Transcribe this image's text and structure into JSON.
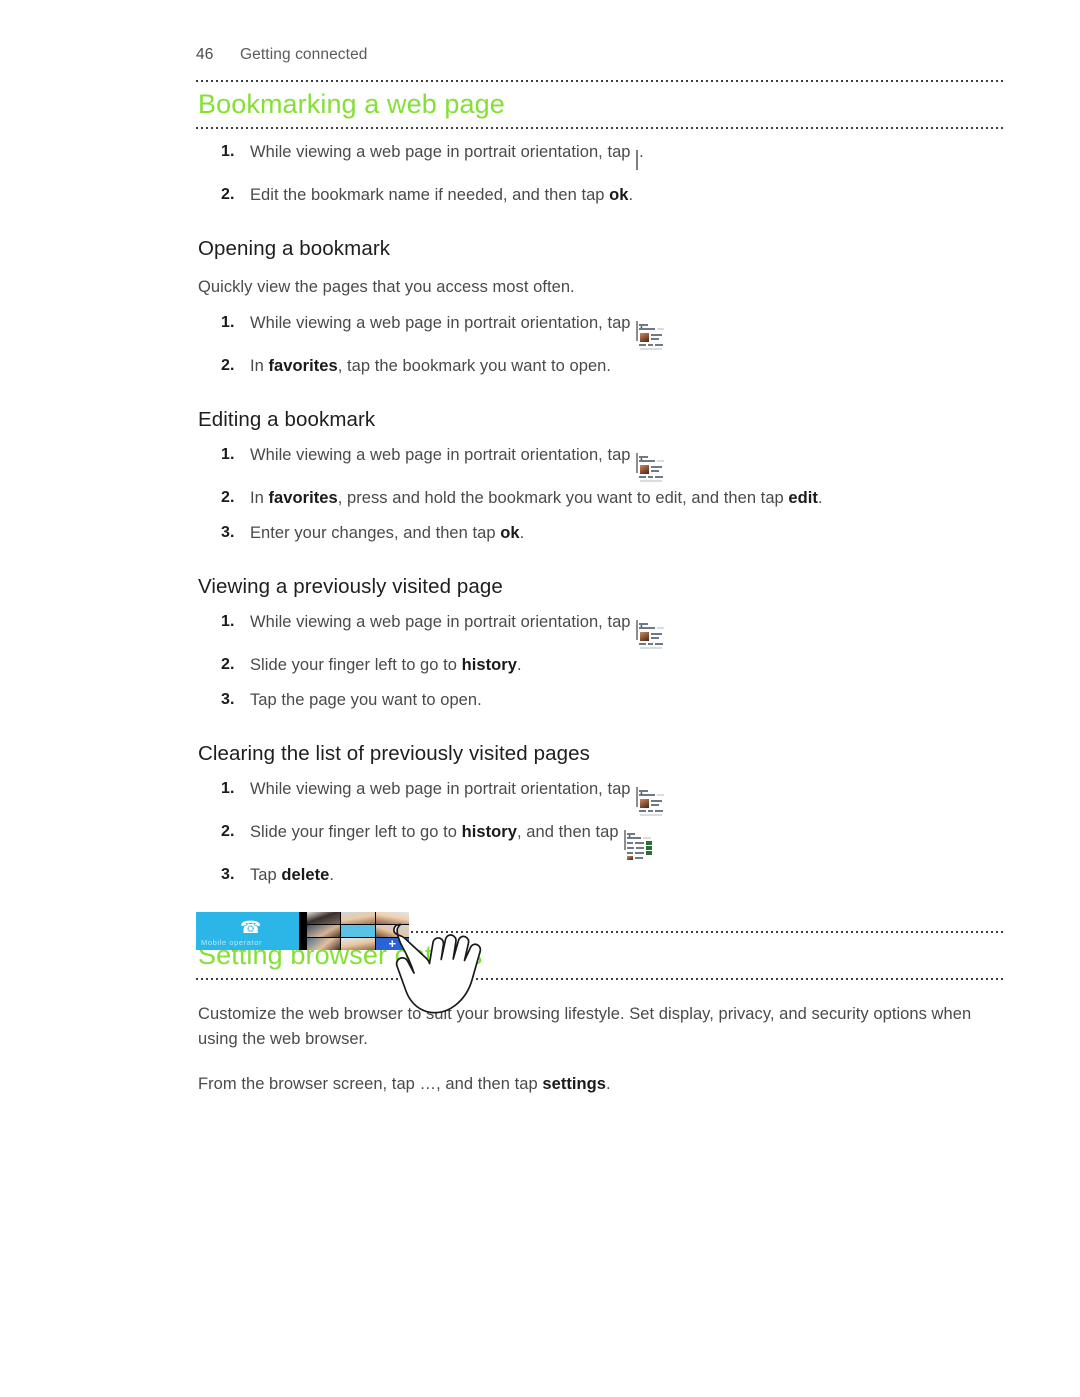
{
  "page": {
    "number": "46",
    "running_head": "Getting connected",
    "accent_green": "#84e035",
    "text_color": "#4a4a4a"
  },
  "sections": [
    {
      "id": "bookmarking",
      "heading": "Bookmarking a web page",
      "steps": [
        {
          "num": "1.",
          "pre": "While viewing a web page in portrait orientation, tap ",
          "icon": "add-bookmark-star-icon",
          "post": "."
        },
        {
          "num": "2.",
          "pre": "Edit the bookmark name if needed, and then tap ",
          "bold": "ok",
          "post": "."
        }
      ],
      "subsections": [
        {
          "id": "opening-a-bookmark",
          "heading": "Opening a bookmark",
          "intro": "Quickly view the pages that you access most often.",
          "steps": [
            {
              "num": "1.",
              "pre": "While viewing a web page in portrait orientation, tap ",
              "icon": "favorites-thumbnail-icon",
              "post": "."
            },
            {
              "num": "2.",
              "pre": "In ",
              "bold": "favorites",
              "post": ", tap the bookmark you want to open."
            }
          ]
        },
        {
          "id": "editing-a-bookmark",
          "heading": "Editing a bookmark",
          "steps": [
            {
              "num": "1.",
              "pre": "While viewing a web page in portrait orientation, tap ",
              "icon": "favorites-thumbnail-icon",
              "post": "."
            },
            {
              "num": "2.",
              "pre": "In ",
              "bold": "favorites",
              "mid": ", press and hold the bookmark you want to edit, and then tap ",
              "bold2": "edit",
              "post": "."
            },
            {
              "num": "3.",
              "pre": "Enter your changes, and then tap ",
              "bold": "ok",
              "post": "."
            }
          ]
        },
        {
          "id": "viewing-previously-visited-page",
          "heading": "Viewing a previously visited page",
          "steps": [
            {
              "num": "1.",
              "pre": "While viewing a web page in portrait orientation, tap ",
              "icon": "favorites-thumbnail-icon",
              "post": "."
            },
            {
              "num": "2.",
              "pre": "Slide your finger left to go to ",
              "bold": "history",
              "post": "."
            },
            {
              "num": "3.",
              "pre": "Tap the page you want to open.",
              "post": ""
            }
          ]
        },
        {
          "id": "clearing-list-previously-visited",
          "heading": "Clearing the list of previously visited pages",
          "steps": [
            {
              "num": "1.",
              "pre": "While viewing a web page in portrait orientation, tap ",
              "icon": "favorites-thumbnail-icon",
              "post": "."
            },
            {
              "num": "2.",
              "pre": "Slide your finger left to go to ",
              "bold": "history",
              "mid": ", and then tap ",
              "icon": "history-list-thumbnail-icon",
              "post": "."
            },
            {
              "num": "3.",
              "pre": "Tap ",
              "bold": "delete",
              "post": "."
            }
          ]
        }
      ]
    },
    {
      "id": "setting-browser-options",
      "heading": "Setting browser options",
      "paragraphs": [
        "Customize the web browser to suit your browsing lifestyle. Set display, privacy, and security options when using the web browser.",
        {
          "pre": "From the browser screen, tap ",
          "ellipsis": "…",
          "mid": ", and then tap ",
          "bold": "settings",
          "post": "."
        }
      ]
    }
  ],
  "figure": {
    "id": "start-screen-tiles-figure",
    "phone_tile": {
      "caption": "Mobile operator",
      "icon": "phone-handset-icon",
      "color": "#2cb6e8"
    },
    "people_tile": {
      "icon": "people-hub-icon",
      "add_glyph": "+"
    },
    "hand": {
      "icon": "pointing-hand-icon"
    }
  }
}
